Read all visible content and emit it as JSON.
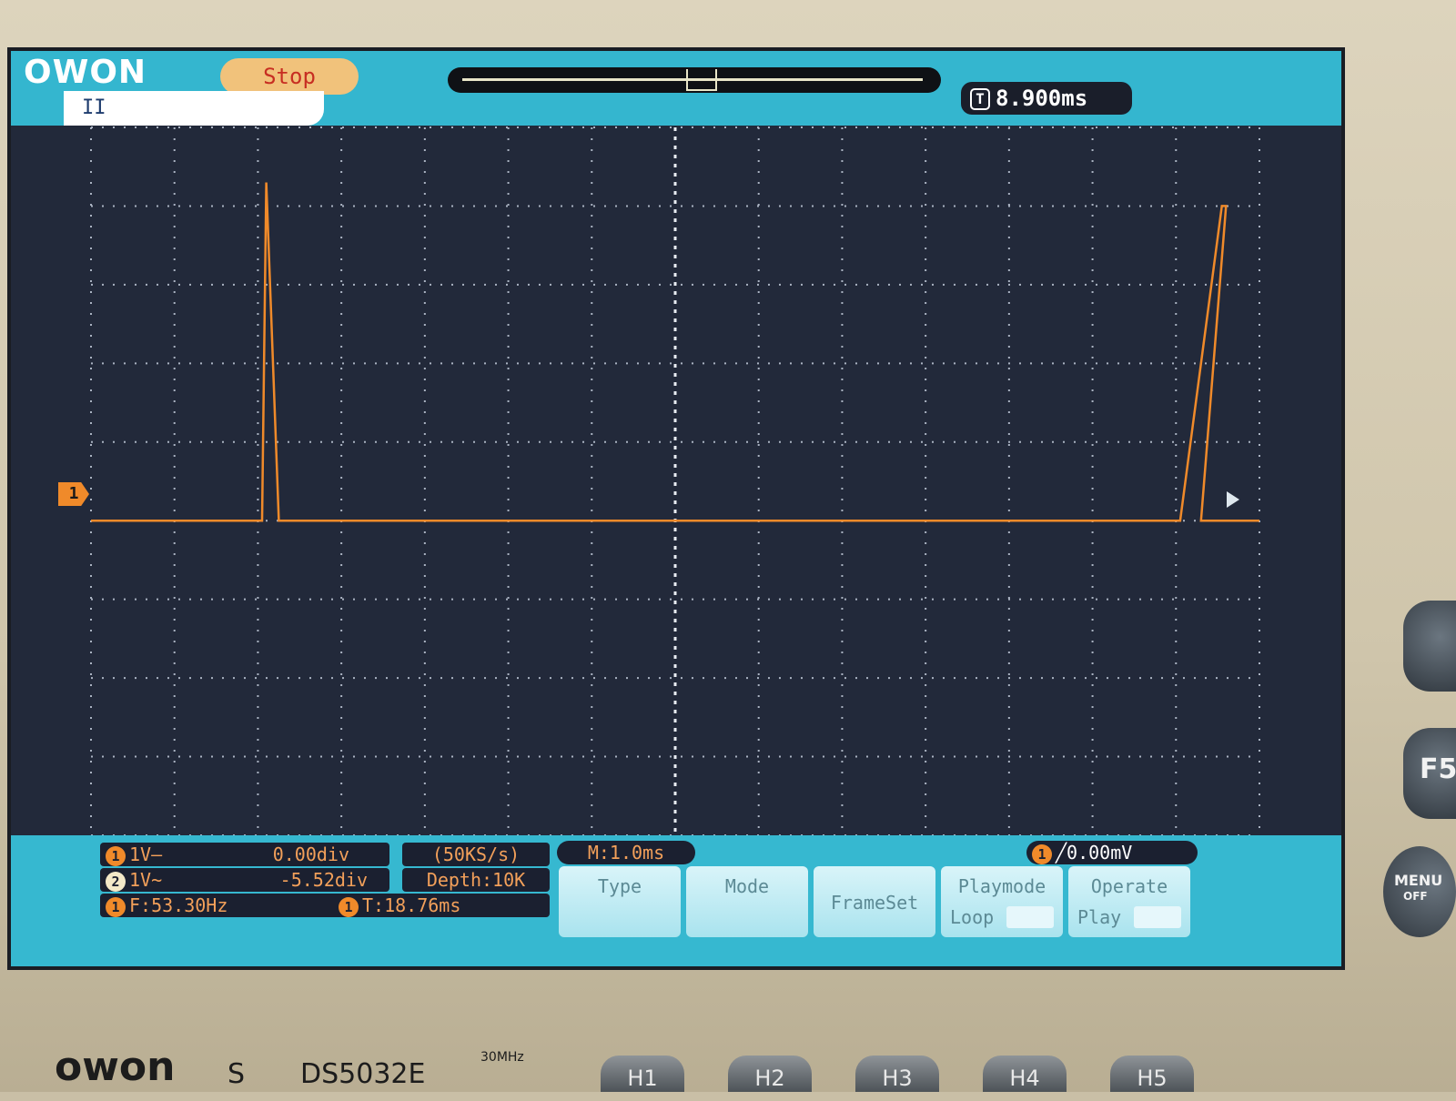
{
  "header": {
    "logo": "OWON",
    "run_state": "Stop",
    "pause_symbol": "II",
    "trigger_position": "8.900ms",
    "trigger_icon": "T"
  },
  "channel1_marker": "1",
  "channel_settings": [
    {
      "badge": "1",
      "coupling": "1V–",
      "offset": "0.00div"
    },
    {
      "badge": "2",
      "coupling": "1V~",
      "offset": "-5.52div"
    }
  ],
  "acquisition": {
    "sample_rate": "(50KS/s)",
    "depth": "Depth:10K"
  },
  "measurements": {
    "badge": "1",
    "frequency": "F:53.30Hz",
    "period_badge": "1",
    "period": "T:18.76ms"
  },
  "timebase": "M:1.0ms",
  "trigger": {
    "badge": "1",
    "level": "0.00mV",
    "edge_icon": "rising-edge-icon"
  },
  "menu": [
    {
      "label": "Type",
      "value": ""
    },
    {
      "label": "Mode",
      "value": ""
    },
    {
      "label": "FrameSet",
      "value": ""
    },
    {
      "label": "Playmode",
      "value": "Loop"
    },
    {
      "label": "Operate",
      "value": "Play"
    }
  ],
  "side_keys": [
    "F5",
    "MENU",
    "OFF"
  ],
  "function_keys": [
    "H1",
    "H2",
    "H3",
    "H4",
    "H5"
  ],
  "device": {
    "brand": "owon",
    "series": "S",
    "model": "DS5032E",
    "bandwidth": "30MHz"
  },
  "colors": {
    "trace": "#f08a2a",
    "screen_bg": "#22293a",
    "ui_cyan": "#34b6cf"
  },
  "chart_data": {
    "type": "line",
    "series": [
      {
        "values": [
          {
            "t_div": -7.0,
            "y_div": 0.0
          },
          {
            "t_div": -4.95,
            "y_div": 0.0
          },
          {
            "t_div": -4.9,
            "y_div": 4.3
          },
          {
            "t_div": -4.75,
            "y_div": 0.0
          },
          {
            "t_div": 6.05,
            "y_div": 0.0
          },
          {
            "t_div": 6.55,
            "y_div": 4.0
          },
          {
            "t_div": 6.6,
            "y_div": 4.0
          },
          {
            "t_div": 6.3,
            "y_div": 0.0
          },
          {
            "t_div": 7.0,
            "y_div": 0.0
          }
        ]
      }
    ],
    "grid": true,
    "xlim": [
      -7,
      7
    ],
    "ylim": [
      -4,
      5
    ]
  }
}
